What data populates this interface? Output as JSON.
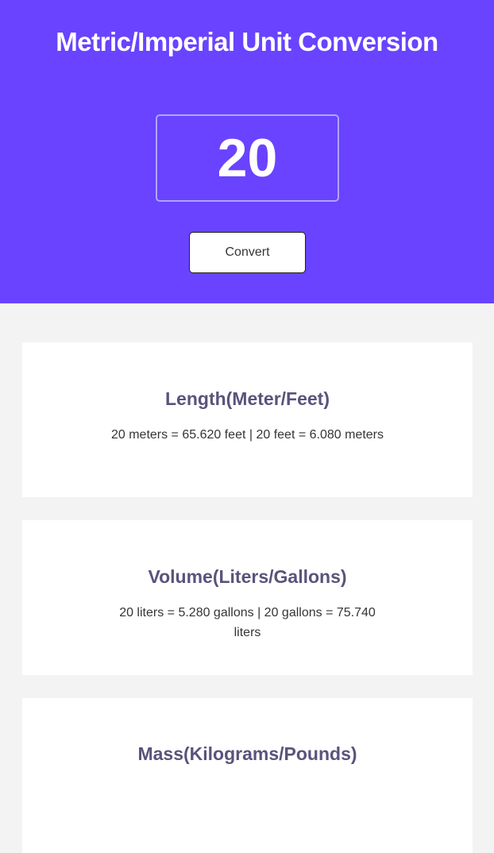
{
  "header": {
    "title": "Metric/Imperial Unit Conversion",
    "input_value": "20",
    "convert_label": "Convert"
  },
  "cards": [
    {
      "title": "Length(Meter/Feet)",
      "text": "20 meters = 65.620 feet | 20 feet = 6.080 meters"
    },
    {
      "title": "Volume(Liters/Gallons)",
      "text": "20 liters = 5.280 gallons | 20 gallons = 75.740 liters"
    },
    {
      "title": "Mass(Kilograms/Pounds)",
      "text": ""
    }
  ],
  "colors": {
    "header_bg": "#6943ff",
    "page_bg": "#f3f3f3",
    "card_title": "#5a537b",
    "card_text": "#353535"
  }
}
